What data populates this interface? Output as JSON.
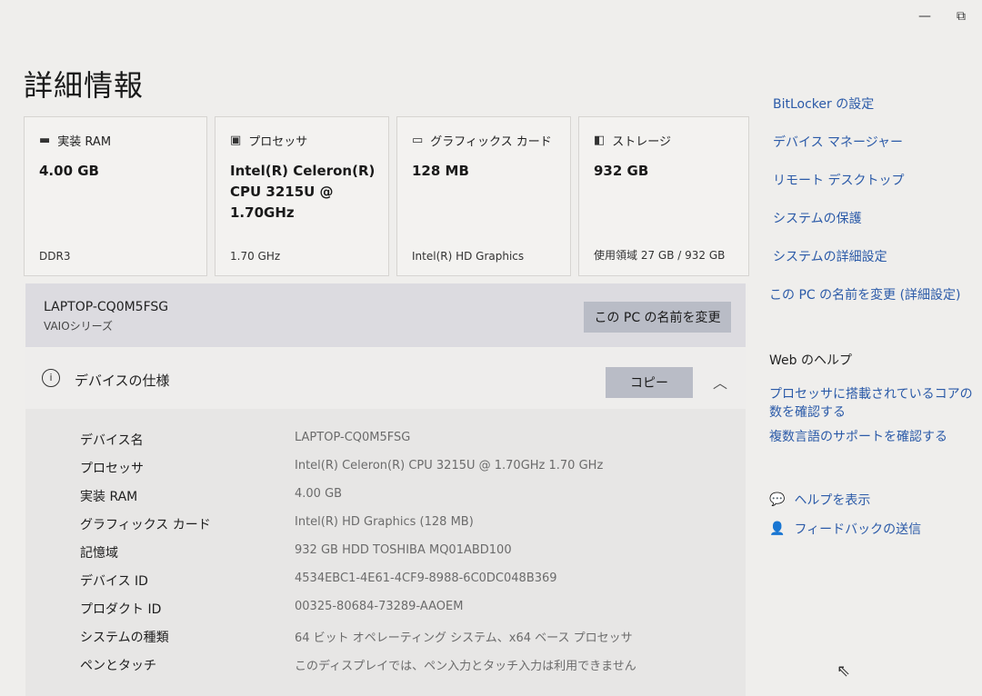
{
  "window": {
    "minimize": "—",
    "restore": "⧉"
  },
  "page_title": "詳細情報",
  "cards": [
    {
      "icon": "▬",
      "label": "実装 RAM",
      "value": "4.00 GB",
      "foot": "DDR3"
    },
    {
      "icon": "▣",
      "label": "プロセッサ",
      "value": "Intel(R) Celeron(R) CPU 3215U @ 1.70GHz",
      "foot": "1.70 GHz"
    },
    {
      "icon": "▭",
      "label": "グラフィックス カード",
      "value": "128 MB",
      "foot": "Intel(R) HD Graphics"
    },
    {
      "icon": "◧",
      "label": "ストレージ",
      "value": "932 GB",
      "foot": "使用領域 27 GB / 932 GB"
    }
  ],
  "device": {
    "name": "LAPTOP-CQ0M5FSG",
    "series": "VAIOシリーズ",
    "rename_label": "この PC の名前を変更"
  },
  "specs": {
    "icon": "i",
    "title": "デバイスの仕様",
    "copy_label": "コピー",
    "collapse_icon": "︿",
    "rows": [
      {
        "label": "デバイス名",
        "value": "LAPTOP-CQ0M5FSG"
      },
      {
        "label": "プロセッサ",
        "value": "Intel(R) Celeron(R) CPU 3215U @ 1.70GHz   1.70 GHz"
      },
      {
        "label": "実装 RAM",
        "value": "4.00 GB"
      },
      {
        "label": "グラフィックス カード",
        "value": "Intel(R) HD Graphics (128 MB)"
      },
      {
        "label": "記憶域",
        "value": "932 GB HDD TOSHIBA MQ01ABD100"
      },
      {
        "label": "デバイス ID",
        "value": "4534EBC1-4E61-4CF9-8988-6C0DC048B369"
      },
      {
        "label": "プロダクト ID",
        "value": "00325-80684-73289-AAOEM"
      },
      {
        "label": "システムの種類",
        "value": "64 ビット オペレーティング システム、x64 ベース プロセッサ"
      },
      {
        "label": "ペンとタッチ",
        "value": "このディスプレイでは、ペン入力とタッチ入力は利用できません"
      }
    ]
  },
  "related_links": [
    "BitLocker の設定",
    "デバイス マネージャー",
    "リモート デスクトップ",
    "システムの保護",
    "システムの詳細設定",
    "この PC の名前を変更 (詳細設定)"
  ],
  "web_help": {
    "title": "Web のヘルプ",
    "links": [
      "プロセッサに搭載されているコアの数を確認する",
      "複数言語のサポートを確認する"
    ]
  },
  "help_items": [
    {
      "icon": "💬",
      "label": "ヘルプを表示"
    },
    {
      "icon": "👤",
      "label": "フィードバックの送信"
    }
  ],
  "colors": {
    "link": "#2b5aa8",
    "button": "#b9bcc6",
    "background": "#efeeec"
  }
}
